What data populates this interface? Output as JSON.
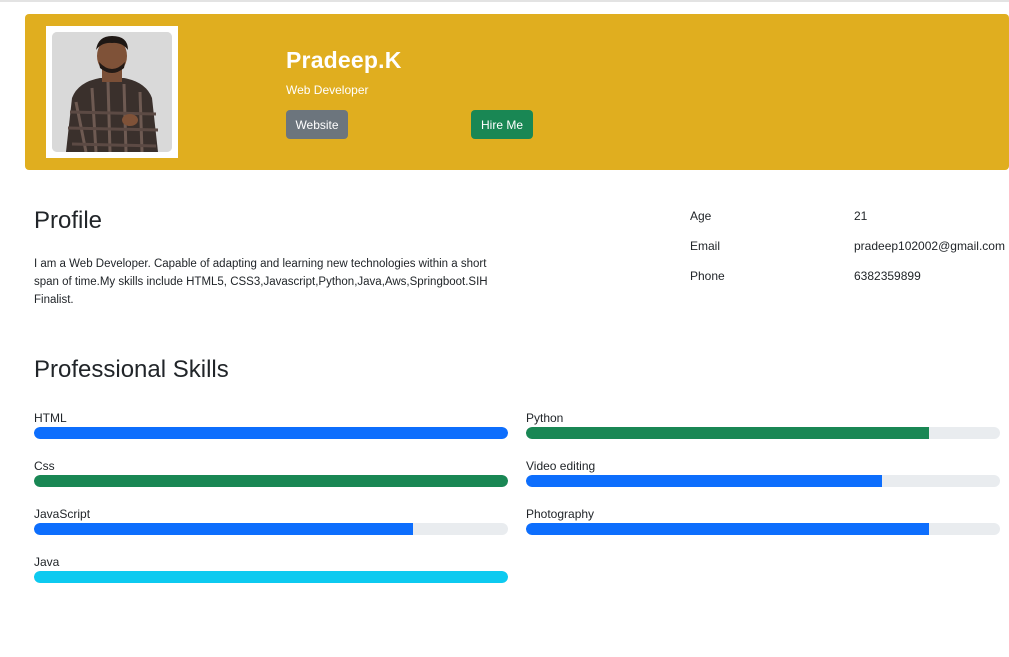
{
  "header": {
    "name": "Pradeep.K",
    "role": "Web Developer",
    "website_label": "Website",
    "hire_label": "Hire Me",
    "background_color": "#e0ae1f"
  },
  "profile": {
    "title": "Profile",
    "description": "I am a Web Developer. Capable of adapting and learning new technologies within a short span of time.My skills include HTML5, CSS3,Javascript,Python,Java,Aws,Springboot.SIH Finalist."
  },
  "info": {
    "age_label": "Age",
    "age_value": "21",
    "email_label": "Email",
    "email_value": "pradeep102002@gmail.com",
    "phone_label": "Phone",
    "phone_value": "6382359899"
  },
  "skills": {
    "title": "Professional Skills",
    "items": [
      {
        "label": "HTML",
        "percent": 100,
        "color": "#0d6efd"
      },
      {
        "label": "Python",
        "percent": 85,
        "color": "#198754"
      },
      {
        "label": "Css",
        "percent": 100,
        "color": "#198754"
      },
      {
        "label": "Video editing",
        "percent": 75,
        "color": "#0d6efd"
      },
      {
        "label": "JavaScript",
        "percent": 80,
        "color": "#0d6efd"
      },
      {
        "label": "Photography",
        "percent": 85,
        "color": "#0d6efd"
      },
      {
        "label": "Java",
        "percent": 100,
        "color": "#0dcaf0"
      }
    ]
  }
}
